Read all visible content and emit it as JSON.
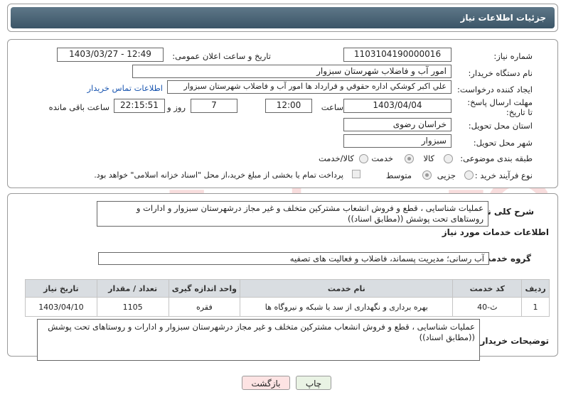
{
  "header": {
    "title": "جزئیات اطلاعات نیاز"
  },
  "form": {
    "need_number_label": "شماره نیاز:",
    "need_number": "1103104190000016",
    "announce_label": "تاریخ و ساعت اعلان عمومی:",
    "announce_value": "1403/03/27 - 12:49",
    "buyer_org_label": "نام دستگاه خریدار:",
    "buyer_org": "امور آب و فاضلاب شهرستان سبزوار",
    "creator_label": "ایجاد کننده درخواست:",
    "creator": "علي اكبر كوشكي اداره حقوقي و قرارداد ها امور آب و فاضلاب شهرستان سبزوار",
    "contact_link": "اطلاعات تماس خریدار",
    "deadline_label": "مهلت ارسال پاسخ: تا تاریخ:",
    "deadline_date": "1403/04/04",
    "time_label": "ساعت",
    "deadline_time": "12:00",
    "days_count": "7",
    "days_label": "روز و",
    "remaining_time": "22:15:51",
    "remaining_label": "ساعت باقی مانده",
    "province_label": "استان محل تحویل:",
    "province": "خراسان رضوی",
    "city_label": "شهر محل تحویل:",
    "city": "سبزوار",
    "category_label": "طبقه بندی موضوعی:",
    "category_options": [
      "کالا",
      "خدمت",
      "کالا/خدمت"
    ],
    "category_selected": "خدمت",
    "process_label": "نوع فرآیند خرید :",
    "process_options": [
      "جزیی",
      "متوسط"
    ],
    "process_selected": "متوسط",
    "payment_note": "پرداخت تمام یا بخشی از مبلغ خرید،از محل \"اسناد خزانه اسلامی\" خواهد بود."
  },
  "summary": {
    "label": "شرح کلی نیاز:",
    "text": "عملیات شناسایی ، قطع و فروش انشعاب مشترکین متخلف و غیر مجاز درشهرستان سبزوار و ادارات و روستاهای تحت پوشش ((مطابق اسناد))"
  },
  "services": {
    "section_title": "اطلاعات خدمات مورد نیاز",
    "group_label": "گروه خدمت:",
    "group_value": "آب رسانی؛ مدیریت پسماند، فاضلاب و فعالیت های تصفیه",
    "columns": [
      "ردیف",
      "کد خدمت",
      "نام خدمت",
      "واحد اندازه گیری",
      "تعداد / مقدار",
      "تاریخ نیاز"
    ],
    "rows": [
      {
        "row": "1",
        "code": "ث-40",
        "name": "بهره برداری و نگهداری از سد یا شبکه و نیروگاه ها",
        "unit": "فقره",
        "qty": "1105",
        "date": "1403/04/10"
      }
    ]
  },
  "buyer_notes": {
    "label": "توضیحات خریدار:",
    "text": "عملیات شناسایی ، قطع و فروش انشعاب مشترکین متخلف و غیر مجاز درشهرستان سبزوار و ادارات و روستاهای تحت پوشش ((مطابق اسناد))"
  },
  "buttons": {
    "print": "چاپ",
    "back": "بازگشت"
  },
  "colors": {
    "header_bg": "#3b5567",
    "link": "#1a56b0",
    "back_button_bg": "#fde3e3",
    "print_button_bg": "#e9f3e4"
  }
}
